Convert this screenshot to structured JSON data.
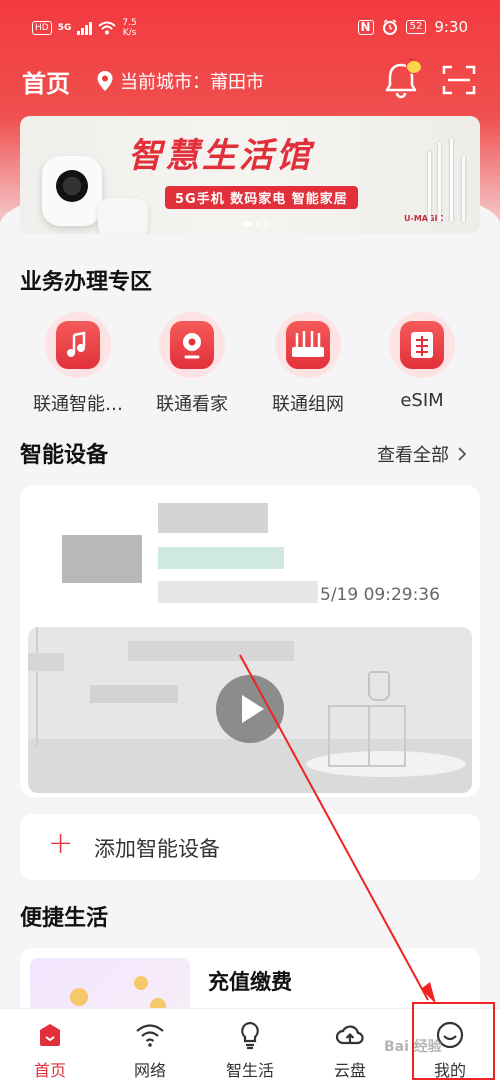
{
  "status_bar": {
    "hd": "HD",
    "network": "5G",
    "speed_value": "7.5",
    "speed_unit": "K/s",
    "nfc": "N",
    "battery": "52",
    "time": "9:30"
  },
  "header": {
    "title": "首页",
    "city": "当前城市：莆田市"
  },
  "banner": {
    "title": "智慧生活馆",
    "subtitle": "5G手机 数码家电 智能家居",
    "brand": "U-MAGIC"
  },
  "services": {
    "title": "业务办理专区",
    "items": [
      {
        "label": "联通智能…",
        "icon": "music-icon"
      },
      {
        "label": "联通看家",
        "icon": "camera-icon"
      },
      {
        "label": "联通组网",
        "icon": "router-icon"
      },
      {
        "label": "eSIM",
        "icon": "sim-icon"
      }
    ]
  },
  "devices": {
    "title": "智能设备",
    "more": "查看全部",
    "timestamp": "5/19 09:29:36",
    "add_label": "添加智能设备"
  },
  "life": {
    "title": "便捷生活",
    "card_label": "充值缴费"
  },
  "tabs": [
    {
      "label": "首页",
      "icon": "home-icon",
      "active": true
    },
    {
      "label": "网络",
      "icon": "wifi-icon",
      "active": false
    },
    {
      "label": "智生活",
      "icon": "bulb-icon",
      "active": false
    },
    {
      "label": "云盘",
      "icon": "cloud-upload-icon",
      "active": false
    },
    {
      "label": "我的",
      "icon": "profile-icon",
      "active": false
    }
  ],
  "watermark": "Bai 经验",
  "colors": {
    "accent": "#e2303a",
    "header_red": "#f23a3f"
  }
}
